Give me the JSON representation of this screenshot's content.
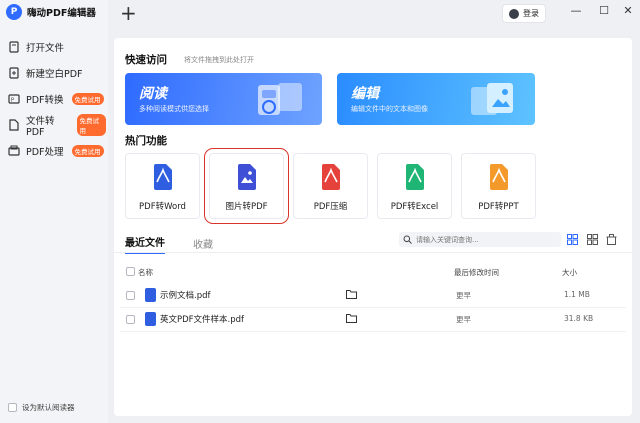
{
  "app": {
    "name": "嗨动PDF编辑器",
    "logo_glyph": "P"
  },
  "sidebar": {
    "items": [
      {
        "label": "打开文件",
        "icon": "open-file-icon",
        "badge": ""
      },
      {
        "label": "新建空白PDF",
        "icon": "new-pdf-icon",
        "badge": ""
      },
      {
        "label": "PDF转换",
        "icon": "pdf-convert-icon",
        "badge": "免费试用"
      },
      {
        "label": "文件转PDF",
        "icon": "file-to-pdf-icon",
        "badge": "免费试用"
      },
      {
        "label": "PDF处理",
        "icon": "pdf-process-icon",
        "badge": "免费试用"
      }
    ],
    "default_reader": "设为默认阅读器"
  },
  "topbar": {
    "new_tab": "+",
    "login": "登录",
    "minimize": "—",
    "maximize": "☐",
    "close": "✕"
  },
  "quick_access": {
    "title": "快速访问",
    "hint": "将文件拖拽到此处打开",
    "banners": [
      {
        "title": "阅读",
        "subtitle": "多种阅读模式供您选择",
        "color": "#2e6bff"
      },
      {
        "title": "编辑",
        "subtitle": "编辑文件中的文本和图像",
        "color": "#2a8cff"
      }
    ]
  },
  "hot_features": {
    "title": "热门功能",
    "tools": [
      {
        "label": "PDF转Word",
        "color": "#2f5fe0"
      },
      {
        "label": "图片转PDF",
        "color": "#3f4fd6"
      },
      {
        "label": "PDF压缩",
        "color": "#e5423b"
      },
      {
        "label": "PDF转Excel",
        "color": "#1fb574"
      },
      {
        "label": "PDF转PPT",
        "color": "#f39a2b"
      }
    ]
  },
  "recent": {
    "tabs": [
      "最近文件",
      "收藏"
    ],
    "search_placeholder": "请输入关键词查询...",
    "columns": {
      "name": "名称",
      "modified": "最后修改时间",
      "size": "大小"
    },
    "files": [
      {
        "name": "示例文档.pdf",
        "modified": "更早",
        "size": "1.1 MB"
      },
      {
        "name": "英文PDF文件样本.pdf",
        "modified": "更早",
        "size": "31.8 KB"
      }
    ]
  },
  "colors": {
    "accent": "#2f6bff",
    "badge": "#ff6a2e",
    "highlight": "#d9342b"
  }
}
